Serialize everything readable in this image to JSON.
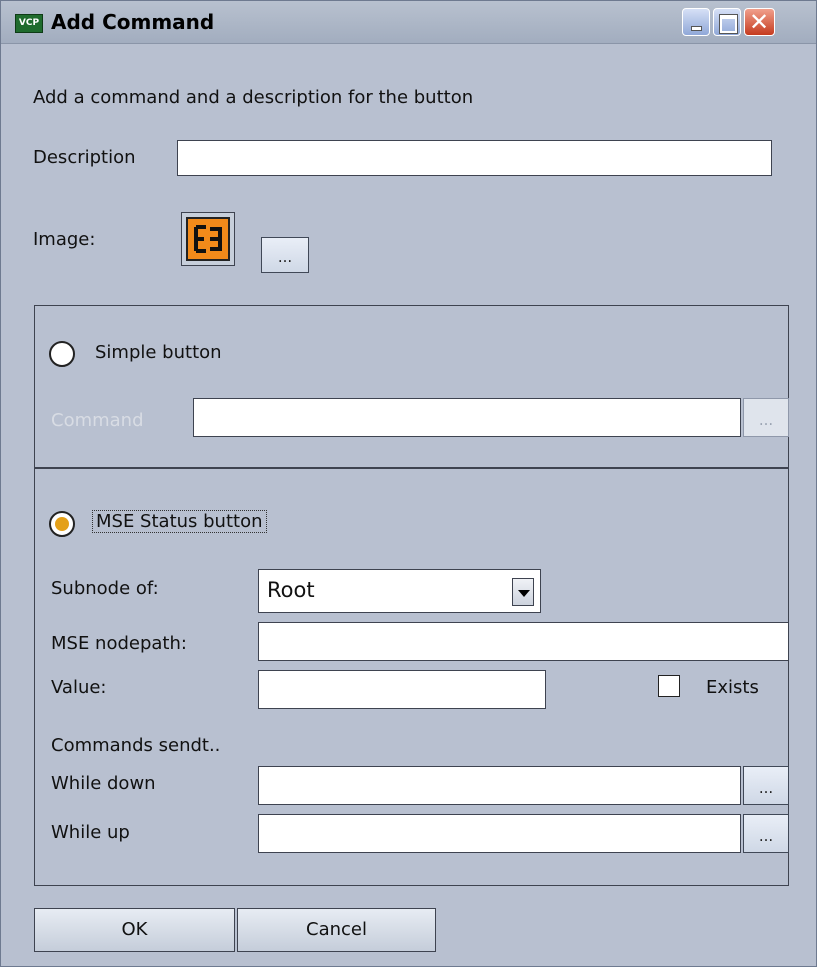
{
  "window": {
    "app_badge": "VCP",
    "title": "Add Command",
    "controls": {
      "minimize": "minimize-icon",
      "maximize": "maximize-icon",
      "close": "close-icon"
    }
  },
  "header": {
    "instructions": "Add a command and a description for the button"
  },
  "description": {
    "label": "Description",
    "value": ""
  },
  "image": {
    "label": "Image:",
    "browse_label": "..."
  },
  "simple": {
    "radio_label": "Simple button",
    "selected": false,
    "command_label": "Command",
    "command_value": "",
    "browse_label": "..."
  },
  "mse": {
    "radio_label": "MSE Status button",
    "selected": true,
    "subnode_label": "Subnode of:",
    "subnode_value": "Root",
    "nodepath_label": "MSE nodepath:",
    "nodepath_value": "",
    "value_label": "Value:",
    "value_value": "",
    "exists_label": "Exists",
    "exists_checked": false,
    "commands_heading": "Commands sendt..",
    "while_down_label": "While down",
    "while_down_value": "",
    "while_up_label": "While up",
    "while_up_value": "",
    "browse_label": "..."
  },
  "footer": {
    "ok_label": "OK",
    "cancel_label": "Cancel"
  },
  "colors": {
    "window_bg": "#b8c0d0",
    "radio_selected": "#e4a019",
    "image_icon": "#f28a1a"
  }
}
